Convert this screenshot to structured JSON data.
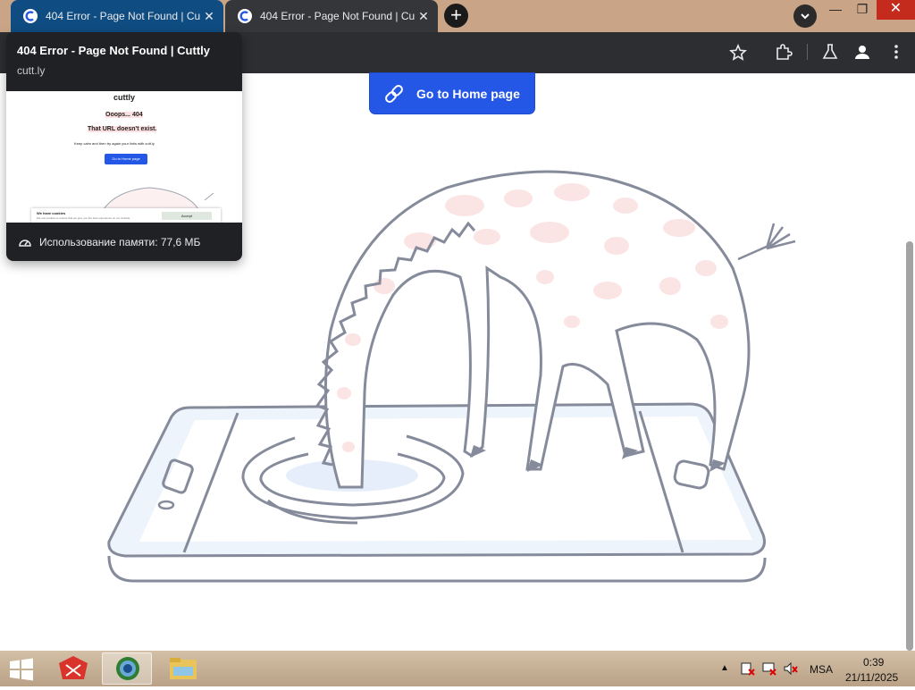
{
  "tabs": [
    {
      "title": "404 Error - Page Not Found | Cu",
      "active": true
    },
    {
      "title": "404 Error - Page Not Found | Cu",
      "active": false
    }
  ],
  "new_tab_label": "+",
  "page": {
    "home_button_label": "Go to Home page"
  },
  "hover_card": {
    "title": "404 Error - Page Not Found | Cuttly",
    "domain": "cutt.ly",
    "memory_text": "Использование памяти: 77,6 МБ",
    "preview": {
      "logo": "cuttly",
      "heading": "Ooops... 404",
      "subheading": "That URL doesn't exist.",
      "note": "Keep calm and then try again your links with cutt.ly",
      "button": "Go to Home page",
      "cookie_title": "We have cookies",
      "cookie_text": "We use cookies to ensure that we give you the best experience on our website",
      "cookie_accept": "Accept"
    }
  },
  "taskbar": {
    "language": "MSA",
    "time": "0:39",
    "date": "21/11/2025"
  },
  "colors": {
    "accent": "#2557e6",
    "tab_active": "#0f4c81",
    "window_close": "#c42b1c"
  },
  "icons": [
    "star-icon",
    "extensions-icon",
    "lab-icon",
    "profile-icon",
    "menu-icon",
    "link-icon",
    "memory-icon",
    "windows-start-icon"
  ]
}
